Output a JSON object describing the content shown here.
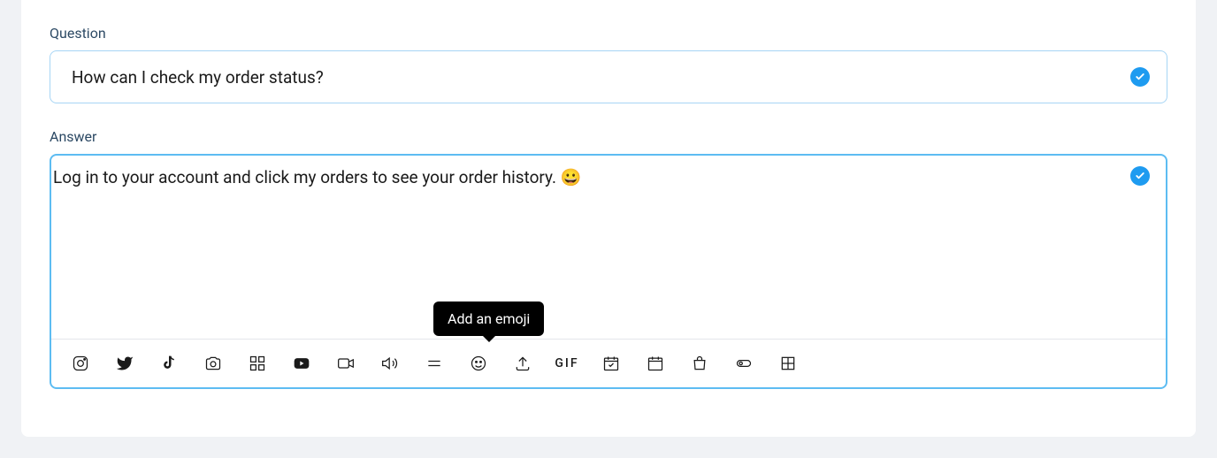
{
  "question": {
    "label": "Question",
    "value": "How can I check my order status?"
  },
  "answer": {
    "label": "Answer",
    "value": "Log in to your account and click my orders to see your order history. 😀"
  },
  "toolbar": {
    "tooltip": "Add an emoji",
    "gif_label": "GIF"
  }
}
